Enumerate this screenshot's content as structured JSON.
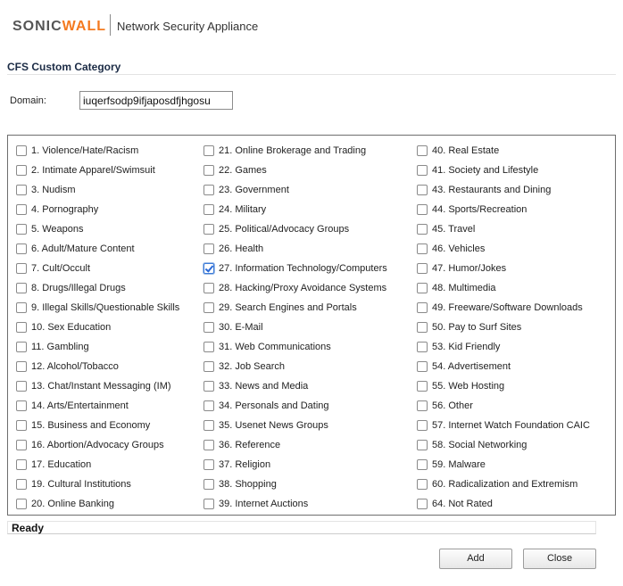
{
  "header": {
    "brand_prefix": "SONIC",
    "brand_suffix": "WALL",
    "product": "Network Security Appliance"
  },
  "section_title": "CFS Custom Category",
  "domain": {
    "label": "Domain:",
    "value": "iuqerfsodp9ifjaposdfjhgosu"
  },
  "columns": [
    [
      {
        "label": "1. Violence/Hate/Racism",
        "checked": false
      },
      {
        "label": "2. Intimate Apparel/Swimsuit",
        "checked": false
      },
      {
        "label": "3. Nudism",
        "checked": false
      },
      {
        "label": "4. Pornography",
        "checked": false
      },
      {
        "label": "5. Weapons",
        "checked": false
      },
      {
        "label": "6. Adult/Mature Content",
        "checked": false
      },
      {
        "label": "7. Cult/Occult",
        "checked": false
      },
      {
        "label": "8. Drugs/Illegal Drugs",
        "checked": false
      },
      {
        "label": "9. Illegal Skills/Questionable Skills",
        "checked": false
      },
      {
        "label": "10. Sex Education",
        "checked": false
      },
      {
        "label": "11. Gambling",
        "checked": false
      },
      {
        "label": "12. Alcohol/Tobacco",
        "checked": false
      },
      {
        "label": "13. Chat/Instant Messaging (IM)",
        "checked": false
      },
      {
        "label": "14. Arts/Entertainment",
        "checked": false
      },
      {
        "label": "15. Business and Economy",
        "checked": false
      },
      {
        "label": "16. Abortion/Advocacy Groups",
        "checked": false
      },
      {
        "label": "17. Education",
        "checked": false
      },
      {
        "label": "19. Cultural Institutions",
        "checked": false
      },
      {
        "label": "20. Online Banking",
        "checked": false
      }
    ],
    [
      {
        "label": "21. Online Brokerage and Trading",
        "checked": false
      },
      {
        "label": "22. Games",
        "checked": false
      },
      {
        "label": "23. Government",
        "checked": false
      },
      {
        "label": "24. Military",
        "checked": false
      },
      {
        "label": "25. Political/Advocacy Groups",
        "checked": false
      },
      {
        "label": "26. Health",
        "checked": false
      },
      {
        "label": "27. Information Technology/Computers",
        "checked": true
      },
      {
        "label": "28. Hacking/Proxy Avoidance Systems",
        "checked": false
      },
      {
        "label": "29. Search Engines and Portals",
        "checked": false
      },
      {
        "label": "30. E-Mail",
        "checked": false
      },
      {
        "label": "31. Web Communications",
        "checked": false
      },
      {
        "label": "32. Job Search",
        "checked": false
      },
      {
        "label": "33. News and Media",
        "checked": false
      },
      {
        "label": "34. Personals and Dating",
        "checked": false
      },
      {
        "label": "35. Usenet News Groups",
        "checked": false
      },
      {
        "label": "36. Reference",
        "checked": false
      },
      {
        "label": "37. Religion",
        "checked": false
      },
      {
        "label": "38. Shopping",
        "checked": false
      },
      {
        "label": "39. Internet Auctions",
        "checked": false
      }
    ],
    [
      {
        "label": "40. Real Estate",
        "checked": false
      },
      {
        "label": "41. Society and Lifestyle",
        "checked": false
      },
      {
        "label": "43. Restaurants and Dining",
        "checked": false
      },
      {
        "label": "44. Sports/Recreation",
        "checked": false
      },
      {
        "label": "45. Travel",
        "checked": false
      },
      {
        "label": "46. Vehicles",
        "checked": false
      },
      {
        "label": "47. Humor/Jokes",
        "checked": false
      },
      {
        "label": "48. Multimedia",
        "checked": false
      },
      {
        "label": "49. Freeware/Software Downloads",
        "checked": false
      },
      {
        "label": "50. Pay to Surf Sites",
        "checked": false
      },
      {
        "label": "53. Kid Friendly",
        "checked": false
      },
      {
        "label": "54. Advertisement",
        "checked": false
      },
      {
        "label": "55. Web Hosting",
        "checked": false
      },
      {
        "label": "56. Other",
        "checked": false
      },
      {
        "label": "57. Internet Watch Foundation CAIC",
        "checked": false
      },
      {
        "label": "58. Social Networking",
        "checked": false
      },
      {
        "label": "59. Malware",
        "checked": false
      },
      {
        "label": "60. Radicalization and Extremism",
        "checked": false
      },
      {
        "label": "64. Not Rated",
        "checked": false
      }
    ]
  ],
  "status": "Ready",
  "buttons": {
    "add": "Add",
    "close": "Close"
  }
}
